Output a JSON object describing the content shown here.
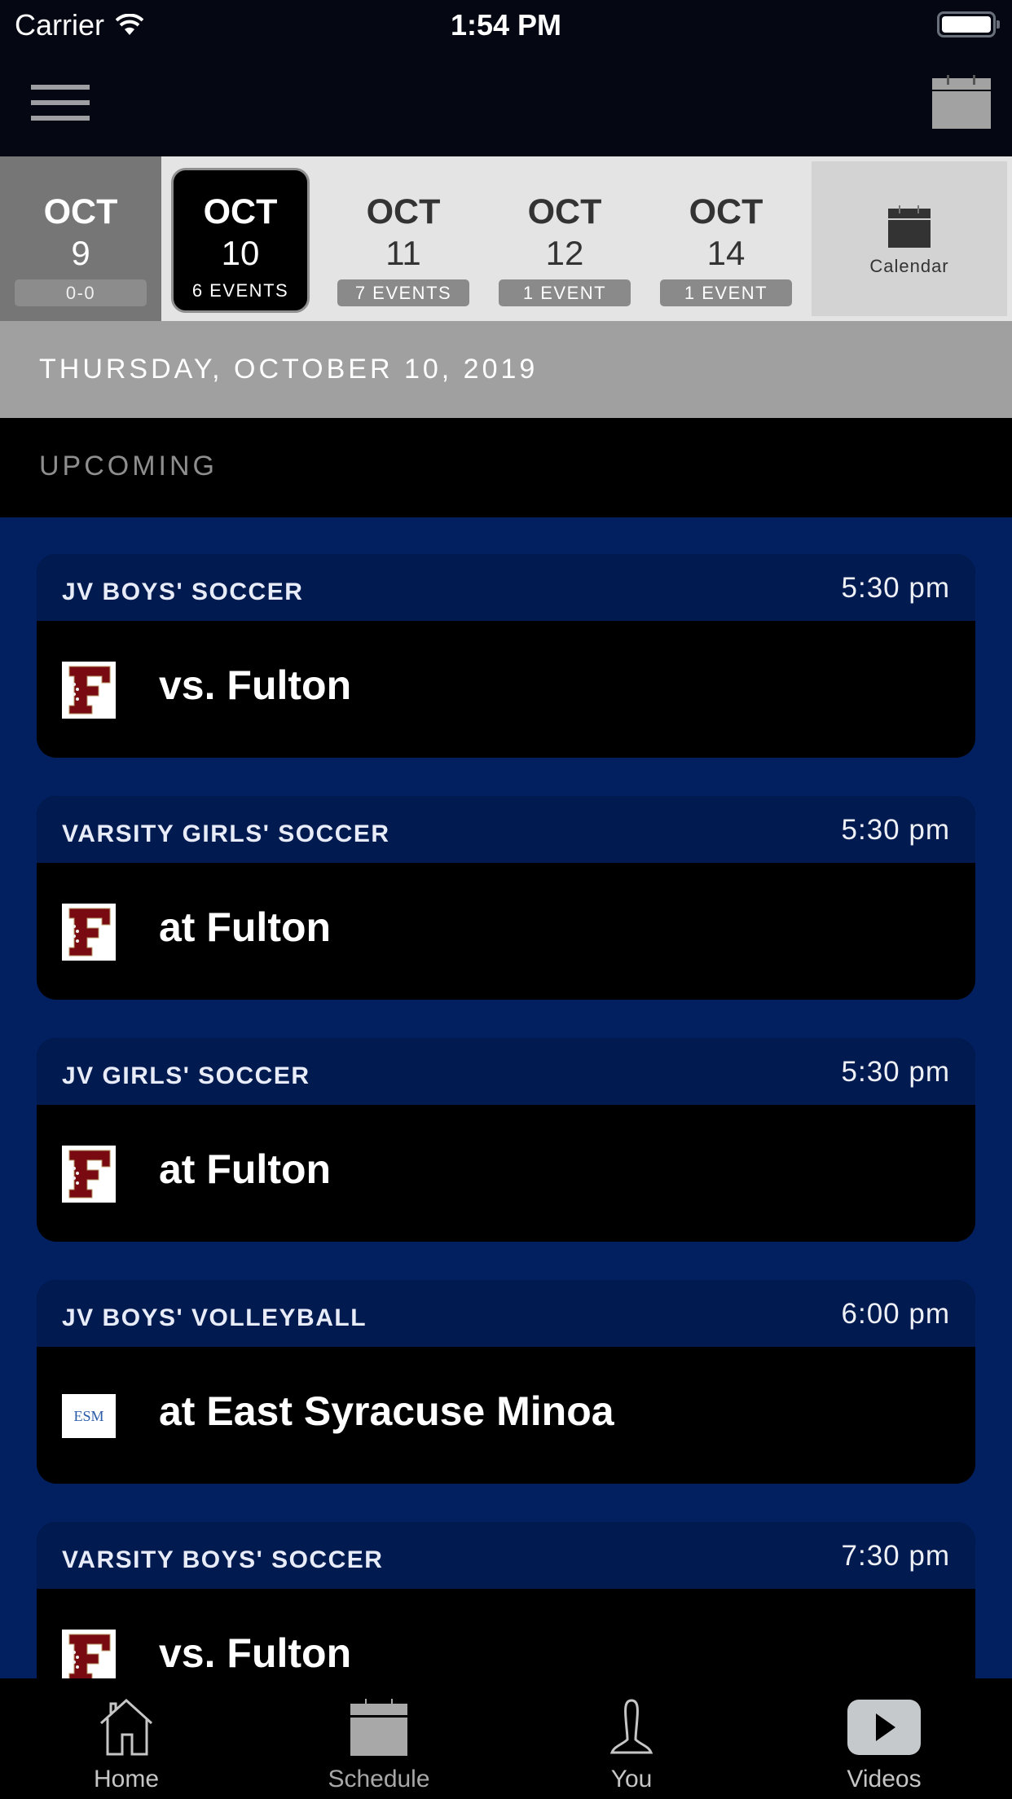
{
  "status_bar": {
    "carrier": "Carrier",
    "time": "1:54 PM"
  },
  "nav": {
    "menu_icon": "hamburger-menu-icon",
    "calendar_icon": "calendar-icon"
  },
  "date_strip": {
    "days": [
      {
        "month": "OCT",
        "day": "9",
        "badge": "0-0",
        "state": "past"
      },
      {
        "month": "OCT",
        "day": "10",
        "badge": "6 EVENTS",
        "state": "selected"
      },
      {
        "month": "OCT",
        "day": "11",
        "badge": "7 EVENTS",
        "state": "normal"
      },
      {
        "month": "OCT",
        "day": "12",
        "badge": "1 EVENT",
        "state": "normal"
      },
      {
        "month": "OCT",
        "day": "14",
        "badge": "1 EVENT",
        "state": "normal"
      }
    ],
    "calendar_label": "Calendar"
  },
  "date_header": "THURSDAY, OCTOBER 10, 2019",
  "section_label": "UPCOMING",
  "events": [
    {
      "sport": "JV BOYS' SOCCER",
      "time": "5:30 pm",
      "opponent": "vs. Fulton",
      "logo": "fulton-logo"
    },
    {
      "sport": "VARSITY GIRLS' SOCCER",
      "time": "5:30 pm",
      "opponent": "at Fulton",
      "logo": "fulton-logo"
    },
    {
      "sport": "JV GIRLS' SOCCER",
      "time": "5:30 pm",
      "opponent": "at Fulton",
      "logo": "fulton-logo"
    },
    {
      "sport": "JV BOYS' VOLLEYBALL",
      "time": "6:00 pm",
      "opponent": "at East Syracuse Minoa",
      "logo": "esm-logo"
    },
    {
      "sport": "VARSITY BOYS' SOCCER",
      "time": "7:30 pm",
      "opponent": "vs. Fulton",
      "logo": "fulton-logo"
    }
  ],
  "logos": {
    "esm_text": "ESM"
  },
  "tab_bar": {
    "tabs": [
      {
        "label": "Home",
        "icon": "home-icon"
      },
      {
        "label": "Schedule",
        "icon": "calendar-icon",
        "active": true
      },
      {
        "label": "You",
        "icon": "person-icon"
      },
      {
        "label": "Videos",
        "icon": "play-icon"
      }
    ]
  },
  "colors": {
    "list_bg": "#02205f",
    "card_header": "#011a4f",
    "fulton_maroon": "#7a0a12"
  }
}
